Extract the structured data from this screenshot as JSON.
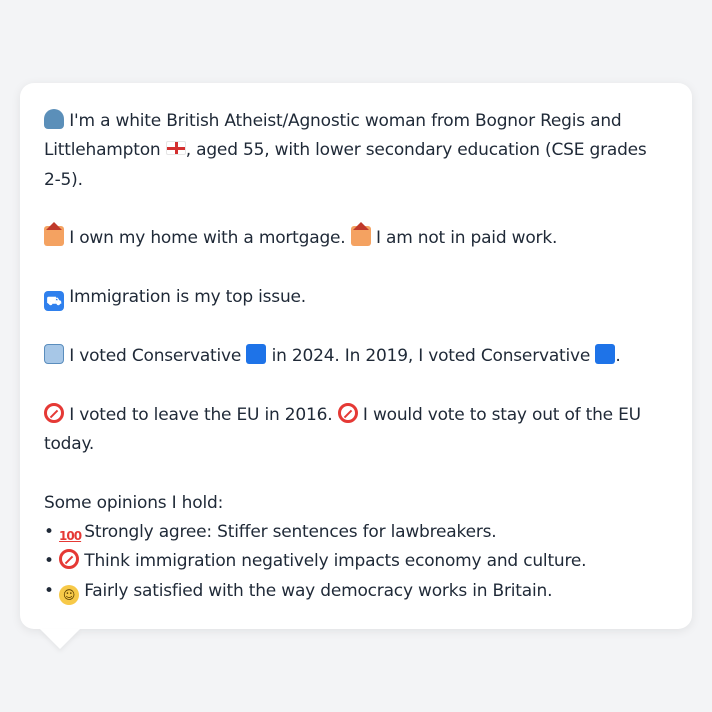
{
  "persona": {
    "intro": {
      "icon": "person-silhouette-icon",
      "text_a": "I'm a white British Atheist/Agnostic woman from Bognor Regis and Littlehampton",
      "flag_icon": "england-flag-icon",
      "text_b": ", aged 55, with lower secondary education (CSE grades 2-5)."
    },
    "home": {
      "icon1": "house-icon",
      "text1": "I own my home with a mortgage.",
      "icon2": "house-icon",
      "text2": "I am not in paid work."
    },
    "issue": {
      "icon": "passport-control-icon",
      "text": "Immigration is my top issue."
    },
    "vote": {
      "icon": "ballot-box-icon",
      "text_a": "I voted Conservative",
      "party_icon_a": "blue-square-icon",
      "text_b": "in 2024. In 2019, I voted Conservative",
      "party_icon_b": "blue-square-icon",
      "text_c": "."
    },
    "eu": {
      "icon1": "no-entry-icon",
      "text1": "I voted to leave the EU in 2016.",
      "icon2": "no-entry-icon",
      "text2": "I would vote to stay out of the EU today."
    },
    "opinions": {
      "heading": "Some opinions I hold:",
      "bullet": "•",
      "items": [
        {
          "icon": "hundred-points-icon",
          "glyph": "100",
          "text": "Strongly agree: Stiffer sentences for lawbreakers."
        },
        {
          "icon": "no-entry-icon",
          "glyph": "",
          "text": "Think immigration negatively impacts economy and culture."
        },
        {
          "icon": "slightly-smiling-face-icon",
          "glyph": "🙂",
          "text": "Fairly satisfied with the way democracy works in Britain."
        }
      ]
    }
  },
  "colors": {
    "background": "#f3f4f6",
    "bubble": "#ffffff",
    "text": "#1f2937",
    "conservative_blue": "#1e73e8"
  }
}
